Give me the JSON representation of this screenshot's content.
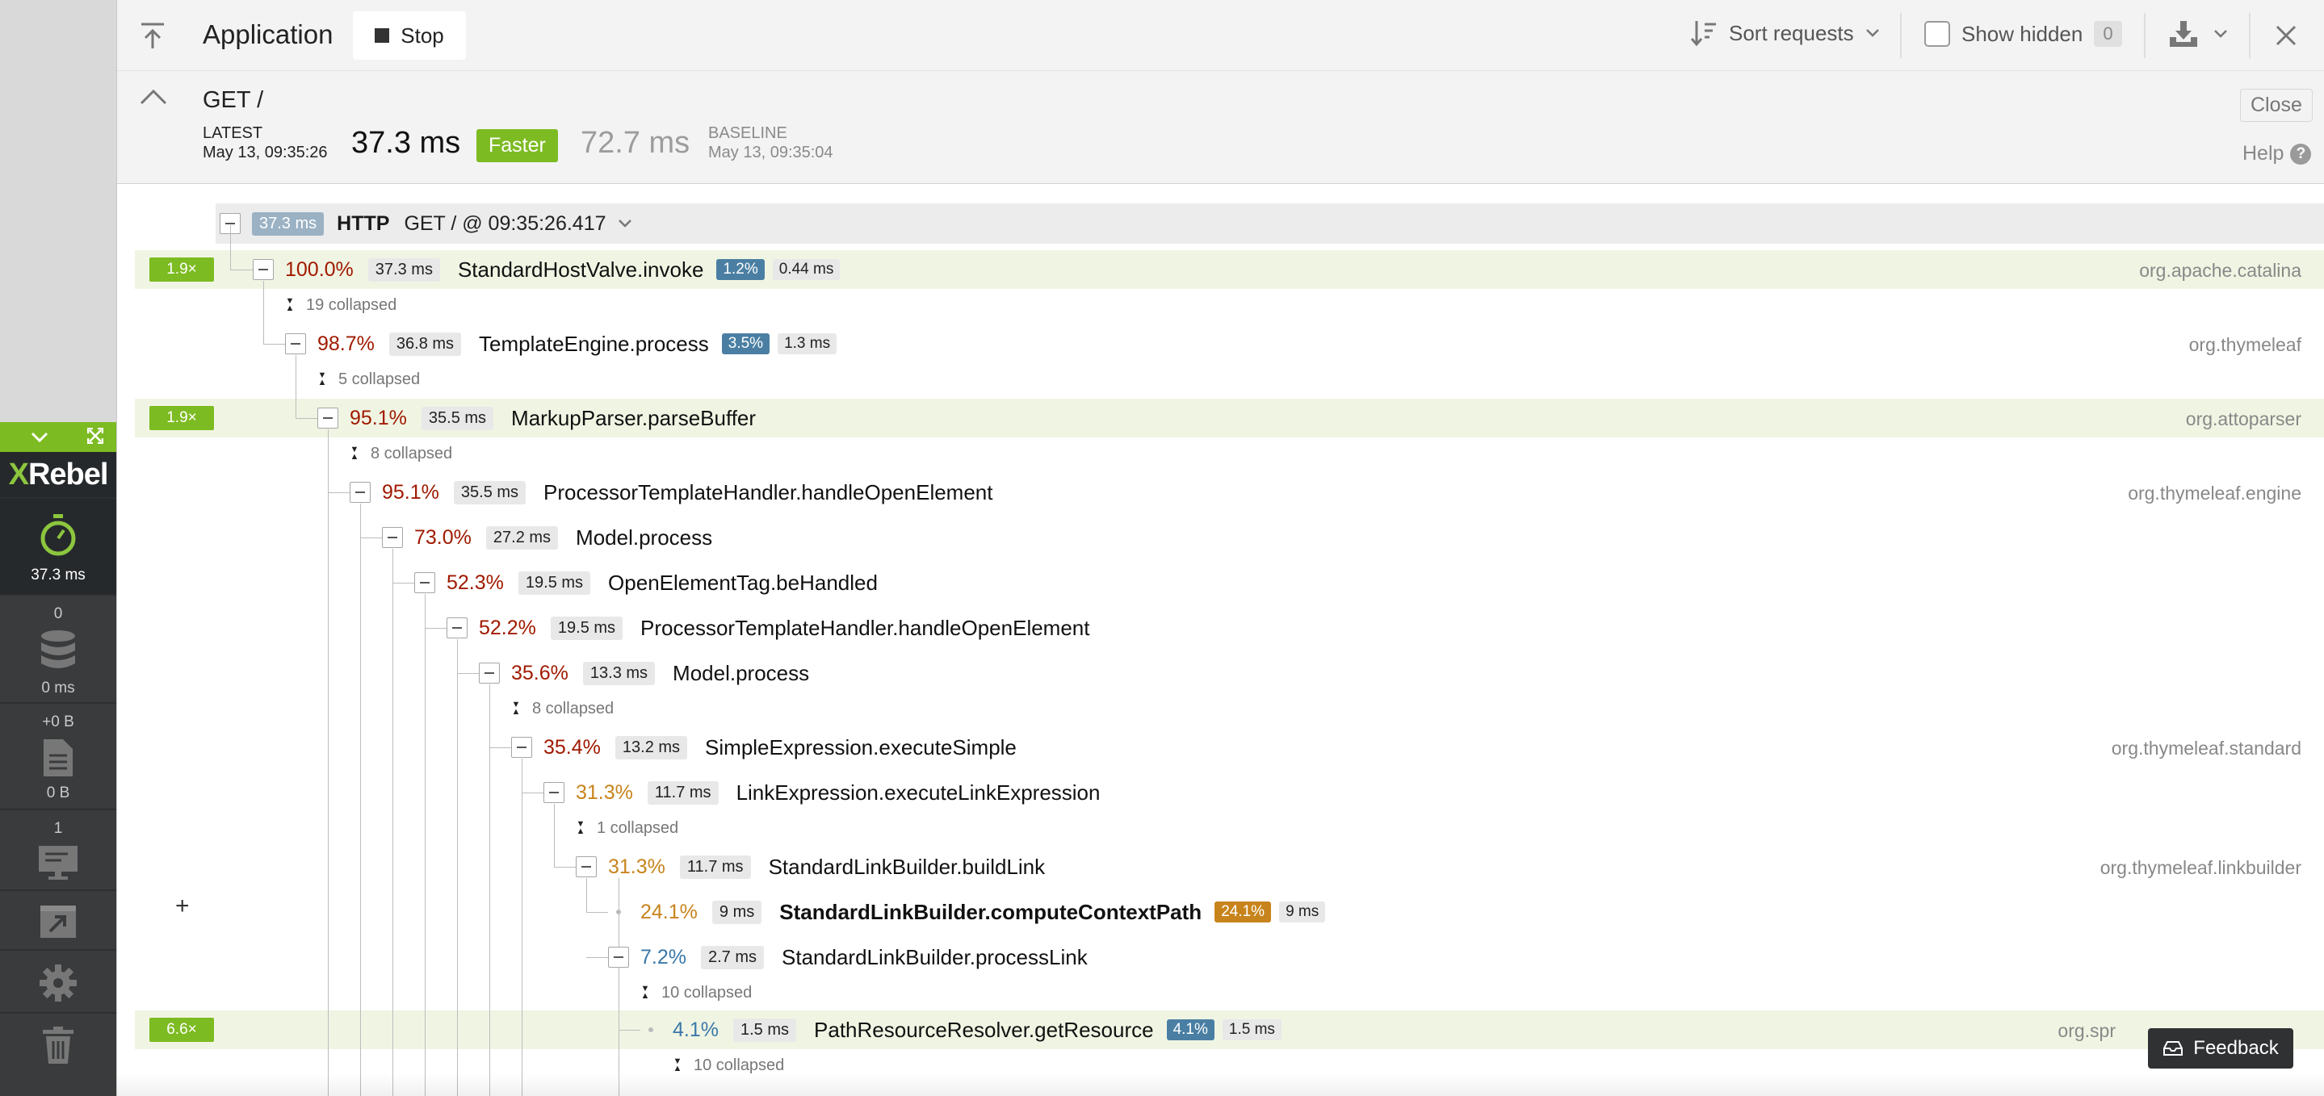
{
  "toolbar": {
    "title": "Application",
    "stop_label": "Stop",
    "sort_label": "Sort requests",
    "show_hidden_label": "Show hidden",
    "hidden_count": "0"
  },
  "request": {
    "title": "GET /",
    "latest_label": "LATEST",
    "latest_date": "May 13, 09:35:26",
    "latest_time": "37.3 ms",
    "faster_label": "Faster",
    "baseline_time": "72.7 ms",
    "baseline_label": "BASELINE",
    "baseline_date": "May 13, 09:35:04",
    "close_label": "Close",
    "help_label": "Help"
  },
  "sidebar": {
    "logo_x": "X",
    "logo_rest": "Rebel",
    "timer_value": "37.3 ms",
    "db_count": "0",
    "db_value": "0 ms",
    "io_count": "+0 B",
    "io_value": "0 B",
    "sessions_count": "1"
  },
  "tree": {
    "http": {
      "ms": "37.3 ms",
      "label": "HTTP",
      "path": "GET / @ 09:35:26.417"
    },
    "nodes": [
      {
        "pct": "100.0%",
        "ms": "37.3 ms",
        "name": "StandardHostValve.invoke",
        "self_pct": "1.2%",
        "self_ms": "0.44 ms",
        "pkg": "org.apache.catalina",
        "mult": "1.9×"
      },
      {
        "pct": "98.7%",
        "ms": "36.8 ms",
        "name": "TemplateEngine.process",
        "self_pct": "3.5%",
        "self_ms": "1.3 ms",
        "pkg": "org.thymeleaf"
      },
      {
        "pct": "95.1%",
        "ms": "35.5 ms",
        "name": "MarkupParser.parseBuffer",
        "pkg": "org.attoparser",
        "mult": "1.9×"
      },
      {
        "pct": "95.1%",
        "ms": "35.5 ms",
        "name": "ProcessorTemplateHandler.handleOpenElement",
        "pkg": "org.thymeleaf.engine"
      },
      {
        "pct": "73.0%",
        "ms": "27.2 ms",
        "name": "Model.process"
      },
      {
        "pct": "52.3%",
        "ms": "19.5 ms",
        "name": "OpenElementTag.beHandled"
      },
      {
        "pct": "52.2%",
        "ms": "19.5 ms",
        "name": "ProcessorTemplateHandler.handleOpenElement"
      },
      {
        "pct": "35.6%",
        "ms": "13.3 ms",
        "name": "Model.process"
      },
      {
        "pct": "35.4%",
        "ms": "13.2 ms",
        "name": "SimpleExpression.executeSimple",
        "pkg": "org.thymeleaf.standard"
      },
      {
        "pct": "31.3%",
        "ms": "11.7 ms",
        "name": "LinkExpression.executeLinkExpression"
      },
      {
        "pct": "31.3%",
        "ms": "11.7 ms",
        "name": "StandardLinkBuilder.buildLink",
        "pkg": "org.thymeleaf.linkbuilder"
      },
      {
        "pct": "24.1%",
        "ms": "9 ms",
        "name": "StandardLinkBuilder.computeContextPath",
        "self_pct": "24.1%",
        "self_ms": "9 ms"
      },
      {
        "pct": "7.2%",
        "ms": "2.7 ms",
        "name": "StandardLinkBuilder.processLink"
      },
      {
        "pct": "4.1%",
        "ms": "1.5 ms",
        "name": "PathResourceResolver.getResource",
        "self_pct": "4.1%",
        "self_ms": "1.5 ms",
        "pkg": "org.spr",
        "mult": "6.6×"
      }
    ],
    "collapsed": [
      "19 collapsed",
      "5 collapsed",
      "8 collapsed",
      "8 collapsed",
      "1 collapsed",
      "10 collapsed",
      "10 collapsed"
    ],
    "plus": "+"
  },
  "feedback_label": "Feedback",
  "colors": {
    "accent_green": "#7dbb22",
    "pct_red": "#a01a00",
    "pct_orange": "#c8841c",
    "pct_blue": "#3a78a8",
    "self_blue": "#4a7fa3",
    "self_orange": "#c8841c"
  },
  "icons": {
    "toolbar": [
      "upload-top-icon",
      "stop-square-icon",
      "sort-icon",
      "chevron-down-icon",
      "checkbox-icon",
      "download-icon",
      "close-icon"
    ],
    "sidebar": [
      "stopwatch-icon",
      "database-icon",
      "file-icon",
      "monitor-icon",
      "export-icon",
      "gear-icon",
      "trash-icon"
    ]
  }
}
